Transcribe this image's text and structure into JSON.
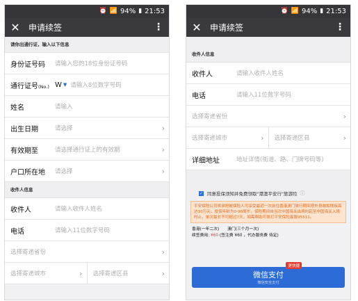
{
  "status": {
    "time": "21:53",
    "battery": "94%"
  },
  "title": "申请续签",
  "left": {
    "section_permit": "请你出通行证，输入以下信息",
    "fields": [
      {
        "label": "身份证号码",
        "value": "请输入您的18位身份证号码",
        "chevron": false
      },
      {
        "label": "通行证号",
        "label_small": "(No.)",
        "prefix": "W",
        "value": "请输入8位数字号码",
        "chevron": false
      },
      {
        "label": "姓名",
        "value": "请输入",
        "chevron": false
      },
      {
        "label": "出生日期",
        "value": "请选择",
        "chevron": true
      },
      {
        "label": "有效期至",
        "value": "请选择通行证上的有效期",
        "chevron": true
      },
      {
        "label": "户口所在地",
        "value": "请选择",
        "chevron": true
      }
    ],
    "section_recipient": "收件人信息",
    "recipient_fields": [
      {
        "label": "收件人",
        "value": "请输入收件人姓名"
      },
      {
        "label": "电话",
        "value": "请输入11位数字号码"
      }
    ],
    "province": "选择寄递省份",
    "city": "选择寄递城市",
    "district": "选择寄递区县"
  },
  "right": {
    "section_recipient": "收件人信息",
    "recipient_fields": [
      {
        "label": "收件人",
        "value": "请输入收件人姓名"
      },
      {
        "label": "电话",
        "value": "请输入11位数字号码"
      }
    ],
    "province": "选择寄递省份",
    "city": "选择寄递城市",
    "district": "选择寄递区县",
    "address_label": "详细地址",
    "address_value": "地址详情(街道、路、门牌号码等)",
    "agree_text": "同意投保须知并免费领取\"港澳平安行\"旅游险",
    "notice_text": "平安保险公司将承担被保险人可享受最近一次前往香港澳门旅行期间意外身故和残疾高达10万元，投保年龄为0-90周岁，保险期间自当次中国海关出境时起至中国海关入境时止，单次最长不可超过7天，如需帮助可拨打平安保险客服95511。",
    "fee_hk": "香港(一年二次)",
    "fee_mo": "澳门(三个月一次)",
    "fee_label": "续签费用:",
    "fee_total": "¥60",
    "fee_detail": "(签注费 ¥60 ，代办服务费 待定)",
    "badge": "更快捷",
    "pay_label": "微信支付",
    "pay_sub": "微信安全支付"
  }
}
